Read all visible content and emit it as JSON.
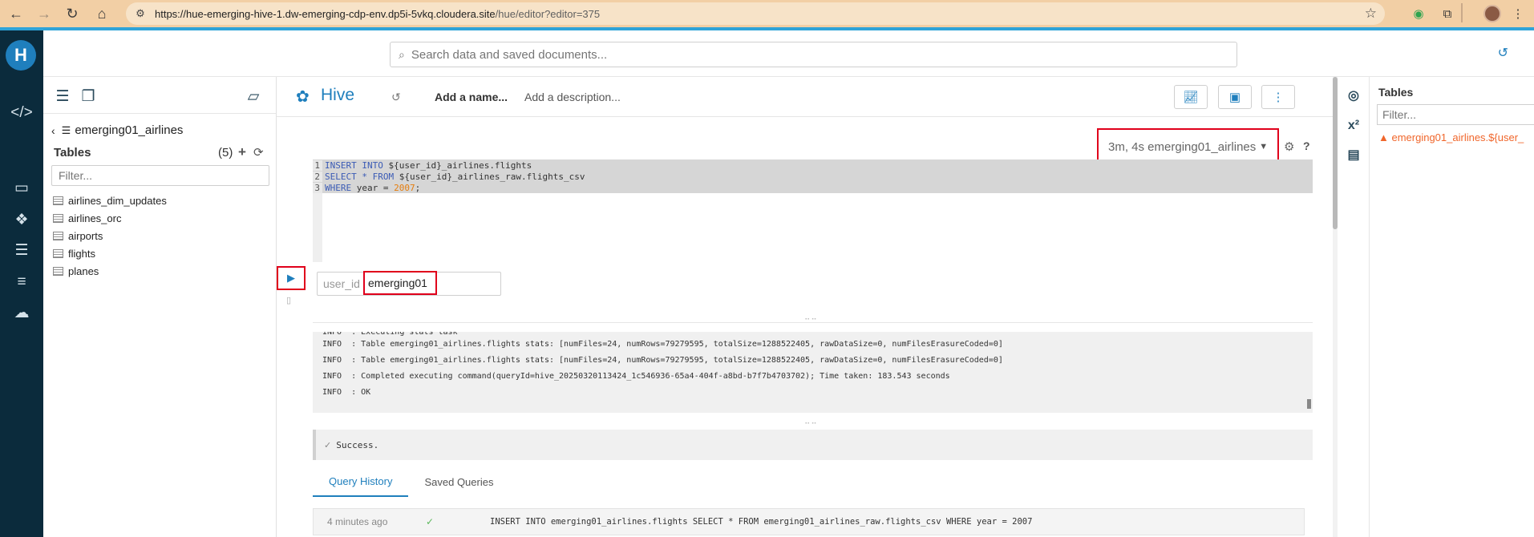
{
  "browser": {
    "back_icon": "arrow-left-icon",
    "url_host": "https://hue-emerging-hive-1.dw-emerging-cdp-env.dp5i-5vkq.cloudera.site",
    "url_path": "/hue/editor?editor=375"
  },
  "topbar": {
    "search_placeholder": "Search data and saved documents..."
  },
  "assist": {
    "database": "emerging01_airlines",
    "tables_label": "Tables",
    "tables_count": "(5)",
    "filter_placeholder": "Filter...",
    "tables": [
      "airlines_dim_updates",
      "airlines_orc",
      "airports",
      "flights",
      "planes"
    ]
  },
  "editor": {
    "engine": "Hive",
    "add_name": "Add a name...",
    "add_description": "Add a description...",
    "session": "3m, 4s emerging01_airlines",
    "code_lines": [
      {
        "no": "1",
        "parts": [
          [
            "kw",
            "INSERT INTO "
          ],
          [
            "var",
            "${user_id}_airlines.flights"
          ]
        ]
      },
      {
        "no": "2",
        "parts": [
          [
            "kw",
            "SELECT * FROM "
          ],
          [
            "var",
            "${user_id}_airlines_raw.flights_csv"
          ]
        ]
      },
      {
        "no": "3",
        "parts": [
          [
            "kw",
            "WHERE "
          ],
          [
            "var",
            "year = "
          ],
          [
            "num",
            "2007"
          ],
          [
            "var",
            ";"
          ]
        ]
      }
    ],
    "param_label": "user_id",
    "param_value": "emerging01",
    "logs": [
      "INFO  : Executing stats task",
      "INFO  : Table emerging01_airlines.flights stats: [numFiles=24, numRows=79279595, totalSize=1288522405, rawDataSize=0, numFilesErasureCoded=0]",
      "INFO  : Table emerging01_airlines.flights stats: [numFiles=24, numRows=79279595, totalSize=1288522405, rawDataSize=0, numFilesErasureCoded=0]",
      "INFO  : Completed executing command(queryId=hive_20250320113424_1c546936-65a4-404f-a8bd-b7f7b4703702); Time taken: 183.543 seconds",
      "INFO  : OK"
    ],
    "success": "Success.",
    "tabs": [
      "Query History",
      "Saved Queries"
    ],
    "history": {
      "time": "4 minutes ago",
      "query": "INSERT INTO emerging01_airlines.flights SELECT * FROM emerging01_airlines_raw.flights_csv WHERE year = 2007"
    }
  },
  "right_panel": {
    "title": "Tables",
    "filter_placeholder": "Filter...",
    "warning": "emerging01_airlines.${user_"
  },
  "colors": {
    "accent": "#1f7fbd",
    "highlight": "#e0001b",
    "nav_bg": "#0b2b3c",
    "browser_bar": "#f2cfa5"
  }
}
